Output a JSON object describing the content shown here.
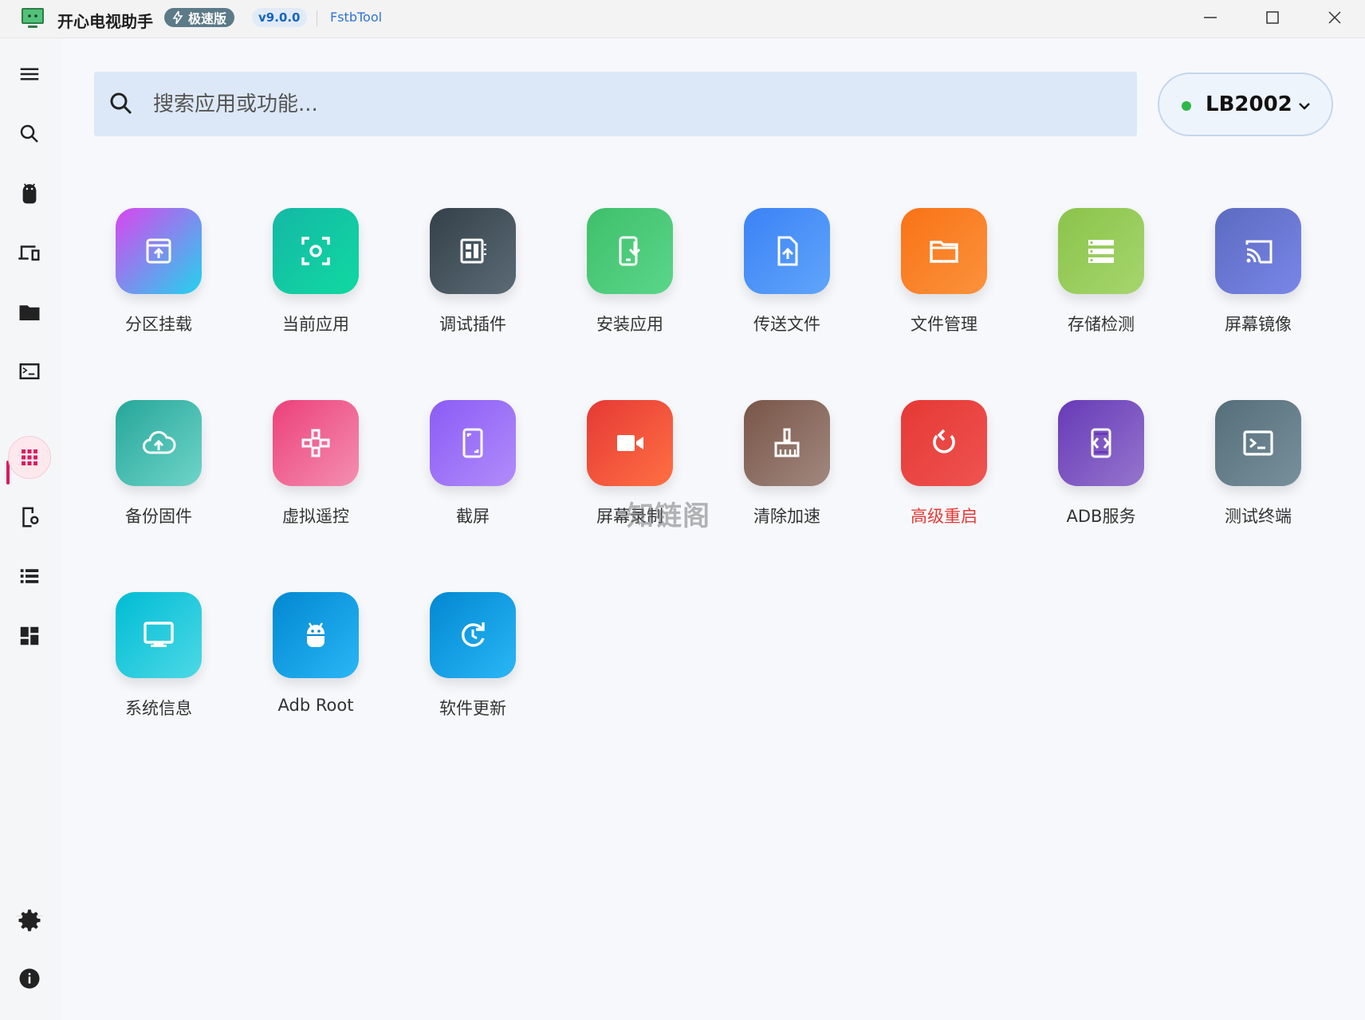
{
  "titlebar": {
    "app_title": "开心电视助手",
    "edition_badge": "极速版",
    "version": "v9.0.0",
    "link": "FstbTool"
  },
  "sidebar": {
    "items": [
      {
        "name": "menu-icon"
      },
      {
        "name": "search-icon"
      },
      {
        "name": "android-icon"
      },
      {
        "name": "devices-icon"
      },
      {
        "name": "folder-icon"
      },
      {
        "name": "terminal-icon"
      },
      {
        "name": "apps-grid-icon",
        "active": true
      },
      {
        "name": "tablet-settings-icon"
      },
      {
        "name": "list-icon"
      },
      {
        "name": "dashboard-icon"
      },
      {
        "name": "gear-icon"
      },
      {
        "name": "info-icon"
      }
    ],
    "accent": "#d81b60"
  },
  "search": {
    "placeholder": "搜索应用或功能...",
    "value": ""
  },
  "device": {
    "name": "LB2002",
    "status_color": "#2db84b"
  },
  "tiles": [
    {
      "label": "分区挂载",
      "icon": "partition-mount-icon",
      "colors": [
        "#d946ef",
        "#22d3ee"
      ]
    },
    {
      "label": "当前应用",
      "icon": "current-app-icon",
      "colors": [
        "#14b8a6",
        "#10d9a0"
      ]
    },
    {
      "label": "调试插件",
      "icon": "debug-plugin-icon",
      "colors": [
        "#34404a",
        "#5b6b75"
      ]
    },
    {
      "label": "安装应用",
      "icon": "install-app-icon",
      "colors": [
        "#3fbf6a",
        "#5ad68a"
      ]
    },
    {
      "label": "传送文件",
      "icon": "send-file-icon",
      "colors": [
        "#3b82f6",
        "#60a5fa"
      ]
    },
    {
      "label": "文件管理",
      "icon": "file-manager-icon",
      "colors": [
        "#f97316",
        "#fb923c"
      ]
    },
    {
      "label": "存储检测",
      "icon": "storage-check-icon",
      "colors": [
        "#8bc34a",
        "#a5d66e"
      ]
    },
    {
      "label": "屏幕镜像",
      "icon": "screen-mirror-icon",
      "colors": [
        "#5c6bc0",
        "#7986e8"
      ]
    },
    {
      "label": "备份固件",
      "icon": "backup-firmware-icon",
      "colors": [
        "#26a69a",
        "#6fd4c8"
      ]
    },
    {
      "label": "虚拟遥控",
      "icon": "virtual-remote-icon",
      "colors": [
        "#ec407a",
        "#f48fb1"
      ]
    },
    {
      "label": "截屏",
      "icon": "screenshot-icon",
      "colors": [
        "#8b5cf6",
        "#b18cfa"
      ]
    },
    {
      "label": "屏幕录制",
      "icon": "screen-record-icon",
      "colors": [
        "#e53935",
        "#ff7043"
      ]
    },
    {
      "label": "清除加速",
      "icon": "clean-boost-icon",
      "colors": [
        "#795548",
        "#a1887f"
      ]
    },
    {
      "label": "高级重启",
      "icon": "advanced-reboot-icon",
      "colors": [
        "#e53935",
        "#ef5350"
      ],
      "danger": true
    },
    {
      "label": "ADB服务",
      "icon": "adb-service-icon",
      "colors": [
        "#673ab7",
        "#9575cd"
      ]
    },
    {
      "label": "测试终端",
      "icon": "test-terminal-icon",
      "colors": [
        "#546e7a",
        "#78909c"
      ]
    },
    {
      "label": "系统信息",
      "icon": "system-info-icon",
      "colors": [
        "#00bcd4",
        "#4dd9e6"
      ]
    },
    {
      "label": "Adb Root",
      "icon": "adb-root-icon",
      "colors": [
        "#0288d1",
        "#29b6f6"
      ]
    },
    {
      "label": "软件更新",
      "icon": "software-update-icon",
      "colors": [
        "#0288d1",
        "#29b6f6"
      ]
    }
  ],
  "watermark": "知链阁"
}
